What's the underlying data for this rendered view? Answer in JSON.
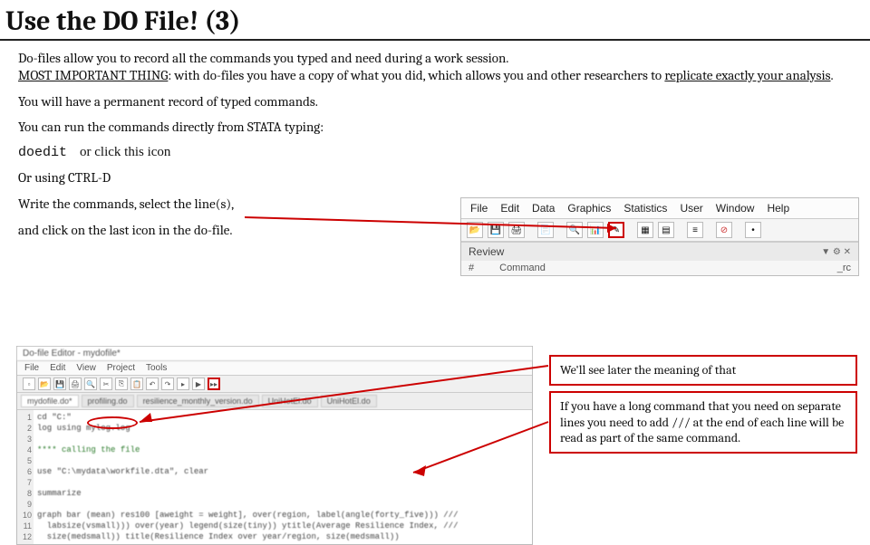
{
  "title": "Use the DO File! (3)",
  "para1a": "Do-files allow you to record all the commands you typed and need during a work session.",
  "para1b_underlined": "MOST IMPORTANT THING",
  "para1b_rest": ": with do-files you have a copy of what you did, which allows you and other researchers to ",
  "para1b_under2": "replicate exactly your analysis",
  "para1b_end": ".",
  "para2": "You will have a permanent record of typed commands.",
  "para3": "You can run the commands directly from STATA typing:",
  "doedit_cmd": "doedit",
  "doedit_hint": "or click this icon",
  "para4": "Or using CTRL-D",
  "para5": "Write the commands, select the line(s),",
  "para6": "and click on the last icon in the do-file.",
  "stata": {
    "menu": [
      "File",
      "Edit",
      "Data",
      "Graphics",
      "Statistics",
      "User",
      "Window",
      "Help"
    ],
    "review_label": "Review",
    "col_num": "#",
    "col_cmd": "Command",
    "col_rc": "_rc"
  },
  "doedit": {
    "title": "Do-file Editor - mydofile*",
    "menu": [
      "File",
      "Edit",
      "View",
      "Project",
      "Tools"
    ],
    "tabs": [
      "mydofile.do*",
      "profiling.do",
      "resilience_monthly_version.do",
      "UniHotEl.do",
      "UniHotEl.do"
    ],
    "lines": [
      "cd \"C:\"",
      "log using mylog.log",
      "",
      "**** calling the file",
      "",
      "use \"C:\\mydata\\workfile.dta\", clear",
      "",
      "summarize",
      "",
      "graph bar (mean) res100 [aweight = weight], over(region, label(angle(forty_five))) ///",
      "  labsize(vsmall))) over(year) legend(size(tiny)) ytitle(Average Resilience Index, ///",
      "  size(medsmall)) title(Resilience Index over year/region, size(medsmall))"
    ]
  },
  "callout1": "We'll see later the meaning of that",
  "callout2": "If you have a long command that you need on separate lines you need to add /// at the end of each line will be read as part of the same command."
}
